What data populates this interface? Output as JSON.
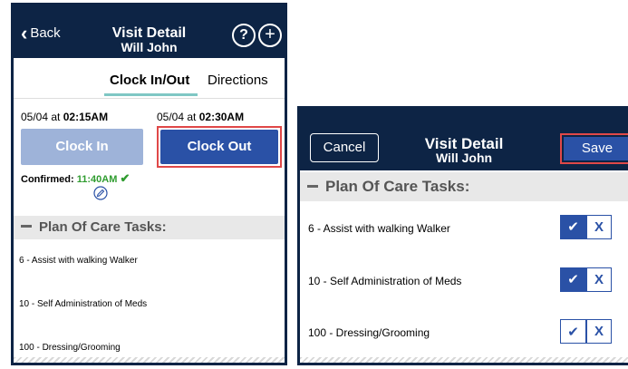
{
  "left_screen": {
    "header": {
      "back_label": "Back",
      "title": "Visit Detail",
      "subtitle": "Will John",
      "help_icon": "?",
      "add_icon": "+"
    },
    "tabs": [
      {
        "label": "Clock In/Out",
        "active": true
      },
      {
        "label": "Directions",
        "active": false
      }
    ],
    "clock_in": {
      "date": "05/04 at ",
      "time": "02:15AM",
      "button_label": "Clock In"
    },
    "clock_out": {
      "date": "05/04 at ",
      "time": "02:30AM",
      "button_label": "Clock Out"
    },
    "confirmed": {
      "label": "Confirmed:",
      "time": "11:40AM"
    },
    "section_title": "Plan Of Care Tasks:",
    "tasks": [
      "6 - Assist with walking Walker",
      "10 - Self Administration of Meds",
      "100 - Dressing/Grooming"
    ]
  },
  "right_screen": {
    "header": {
      "cancel_label": "Cancel",
      "title": "Visit Detail",
      "subtitle": "Will John",
      "save_label": "Save"
    },
    "section_title": "Plan Of Care Tasks:",
    "tasks": [
      {
        "label": "6 - Assist with walking Walker",
        "checked": true
      },
      {
        "label": "10 - Self Administration of Meds",
        "checked": true
      },
      {
        "label": "100 - Dressing/Grooming",
        "checked": false
      }
    ],
    "toggle_x_label": "X"
  },
  "colors": {
    "header_bg": "#0d2445",
    "primary": "#2a51a6",
    "disabled": "#9eb3d9",
    "highlight": "#e04848",
    "confirm": "#2f9c2f",
    "tab_underline": "#7fc7c4"
  }
}
